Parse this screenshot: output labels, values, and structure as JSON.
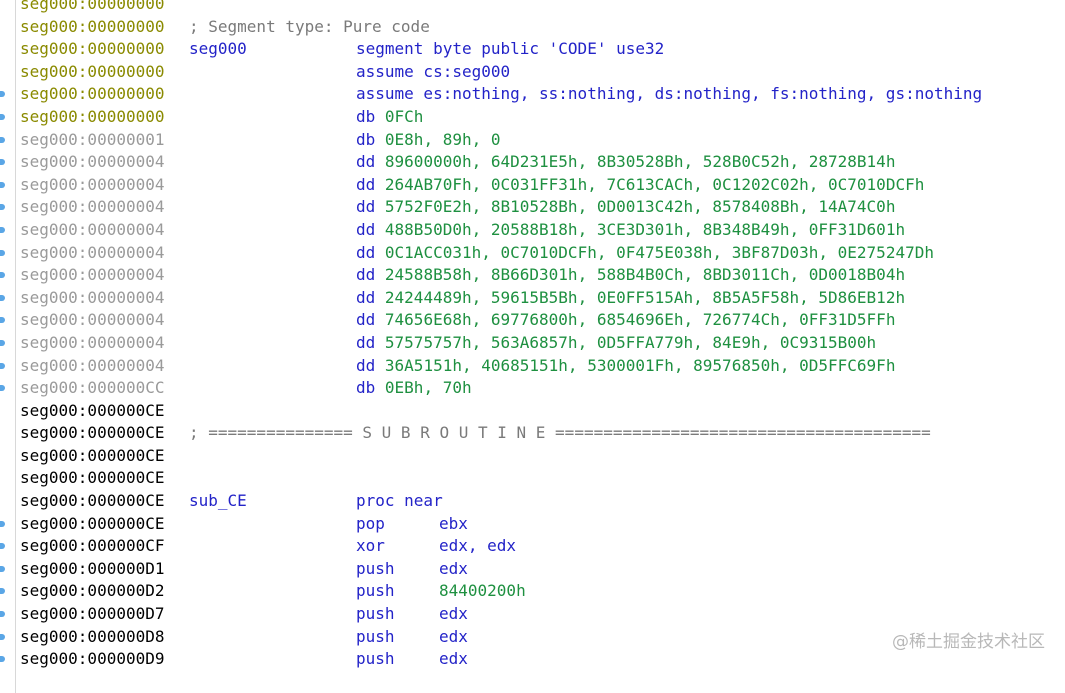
{
  "rows": [
    {
      "addr": "seg000:00000000",
      "addr_color": "olive",
      "dot": false
    },
    {
      "addr": "seg000:00000000",
      "addr_color": "olive",
      "dot": false,
      "comment": "; Segment type: Pure code"
    },
    {
      "addr": "seg000:00000000",
      "addr_color": "olive",
      "dot": false,
      "label": "seg000",
      "mnem": "segment byte public 'CODE' use32"
    },
    {
      "addr": "seg000:00000000",
      "addr_color": "olive",
      "dot": false,
      "mnem": "assume cs:seg000"
    },
    {
      "addr": "seg000:00000000",
      "addr_color": "olive",
      "dot": true,
      "mnem": "assume es:nothing, ss:nothing, ds:nothing, fs:nothing, gs:nothing"
    },
    {
      "addr": "seg000:00000000",
      "addr_color": "olive",
      "dot": true,
      "mnem": "db",
      "operand_tail": "0FCh",
      "tail_type": "num"
    },
    {
      "addr": "seg000:00000001",
      "addr_color": "gray",
      "dot": true,
      "mnem": "db",
      "operand_tail": "0E8h, 89h, 0",
      "tail_type": "num"
    },
    {
      "addr": "seg000:00000004",
      "addr_color": "gray",
      "dot": true,
      "mnem": "dd",
      "operand_tail": "89600000h, 64D231E5h, 8B30528Bh, 528B0C52h, 28728B14h",
      "tail_type": "num"
    },
    {
      "addr": "seg000:00000004",
      "addr_color": "gray",
      "dot": true,
      "mnem": "dd",
      "operand_tail": "264AB70Fh, 0C031FF31h, 7C613CACh, 0C1202C02h, 0C7010DCFh",
      "tail_type": "num"
    },
    {
      "addr": "seg000:00000004",
      "addr_color": "gray",
      "dot": true,
      "mnem": "dd",
      "operand_tail": "5752F0E2h, 8B10528Bh, 0D0013C42h, 8578408Bh, 14A74C0h",
      "tail_type": "num"
    },
    {
      "addr": "seg000:00000004",
      "addr_color": "gray",
      "dot": true,
      "mnem": "dd",
      "operand_tail": "488B50D0h, 20588B18h, 3CE3D301h, 8B348B49h, 0FF31D601h",
      "tail_type": "num"
    },
    {
      "addr": "seg000:00000004",
      "addr_color": "gray",
      "dot": true,
      "mnem": "dd",
      "operand_tail": "0C1ACC031h, 0C7010DCFh, 0F475E038h, 3BF87D03h, 0E275247Dh",
      "tail_type": "num"
    },
    {
      "addr": "seg000:00000004",
      "addr_color": "gray",
      "dot": true,
      "mnem": "dd",
      "operand_tail": "24588B58h, 8B66D301h, 588B4B0Ch, 8BD3011Ch, 0D0018B04h",
      "tail_type": "num"
    },
    {
      "addr": "seg000:00000004",
      "addr_color": "gray",
      "dot": true,
      "mnem": "dd",
      "operand_tail": "24244489h, 59615B5Bh, 0E0FF515Ah, 8B5A5F58h, 5D86EB12h",
      "tail_type": "num"
    },
    {
      "addr": "seg000:00000004",
      "addr_color": "gray",
      "dot": true,
      "mnem": "dd",
      "operand_tail": "74656E68h, 69776800h, 6854696Eh, 726774Ch, 0FF31D5FFh",
      "tail_type": "num"
    },
    {
      "addr": "seg000:00000004",
      "addr_color": "gray",
      "dot": true,
      "mnem": "dd",
      "operand_tail": "57575757h, 563A6857h, 0D5FFA779h, 84E9h, 0C9315B00h",
      "tail_type": "num"
    },
    {
      "addr": "seg000:00000004",
      "addr_color": "gray",
      "dot": true,
      "mnem": "dd",
      "operand_tail": "36A5151h, 40685151h, 5300001Fh, 89576850h, 0D5FFC69Fh",
      "tail_type": "num"
    },
    {
      "addr": "seg000:000000CC",
      "addr_color": "gray",
      "dot": true,
      "mnem": "db",
      "operand_tail": "0EBh, 70h",
      "tail_type": "num"
    },
    {
      "addr": "seg000:000000CE",
      "addr_color": "black",
      "dot": false
    },
    {
      "addr": "seg000:000000CE",
      "addr_color": "black",
      "dot": false,
      "comment": "; =============== S U B R O U T I N E ======================================="
    },
    {
      "addr": "seg000:000000CE",
      "addr_color": "black",
      "dot": false
    },
    {
      "addr": "seg000:000000CE",
      "addr_color": "black",
      "dot": false
    },
    {
      "addr": "seg000:000000CE",
      "addr_color": "black",
      "dot": false,
      "label": "sub_CE",
      "mnem": "proc near"
    },
    {
      "addr": "seg000:000000CE",
      "addr_color": "black",
      "dot": true,
      "mnem": "pop",
      "operand": "ebx",
      "op_type": "reg"
    },
    {
      "addr": "seg000:000000CF",
      "addr_color": "black",
      "dot": true,
      "mnem": "xor",
      "operand": "edx, edx",
      "op_type": "reg"
    },
    {
      "addr": "seg000:000000D1",
      "addr_color": "black",
      "dot": true,
      "mnem": "push",
      "operand": "edx",
      "op_type": "reg"
    },
    {
      "addr": "seg000:000000D2",
      "addr_color": "black",
      "dot": true,
      "mnem": "push",
      "operand": "84400200h",
      "op_type": "num"
    },
    {
      "addr": "seg000:000000D7",
      "addr_color": "black",
      "dot": true,
      "mnem": "push",
      "operand": "edx",
      "op_type": "reg"
    },
    {
      "addr": "seg000:000000D8",
      "addr_color": "black",
      "dot": true,
      "mnem": "push",
      "operand": "edx",
      "op_type": "reg"
    },
    {
      "addr": "seg000:000000D9",
      "addr_color": "black",
      "dot": true,
      "mnem": "push",
      "operand": "edx",
      "op_type": "reg"
    }
  ],
  "watermark": "@稀土掘金技术社区",
  "colors": {
    "address_olive": "#8a8a00",
    "address_gray": "#9a9a9a",
    "keyword_blue": "#2323c8",
    "number_green": "#1e9040",
    "comment_gray": "#7a7a7a",
    "gutter_dot": "#5aa6e6"
  }
}
